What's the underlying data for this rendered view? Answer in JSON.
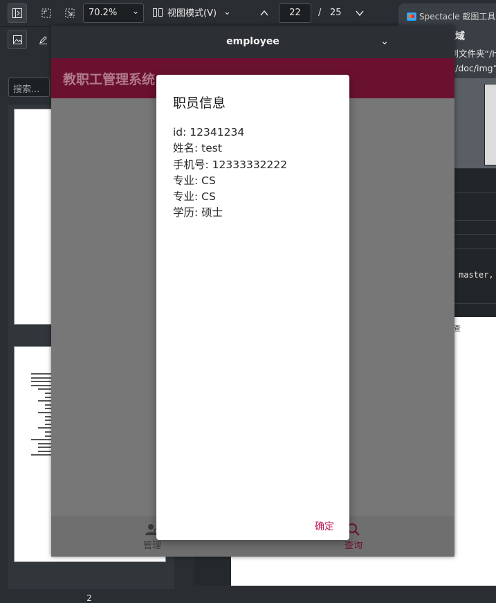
{
  "toolbar": {
    "zoom_value": "70.2%",
    "view_mode_label": "视图模式(V)",
    "current_page": "22",
    "page_separator": "/",
    "total_pages": "25"
  },
  "sidebar": {
    "search_placeholder": "搜索...",
    "thumbnail_label": "2"
  },
  "notification": {
    "app_name": "Spectacle 截图工具",
    "title": "绘制矩形区域",
    "body_line1": "截图已保存到文件夹“/h",
    "body_line2": "cpp/Design/doc/img”"
  },
  "terminal": {
    "text": "master,"
  },
  "document": {
    "fragment": "查"
  },
  "app": {
    "window_title": "employee",
    "header_title": "教职工管理系统",
    "tabs": {
      "manage": "管理",
      "query": "查询"
    },
    "colors": {
      "header": "#6b1130",
      "accent": "#c2185b"
    }
  },
  "dialog": {
    "title": "职员信息",
    "fields": [
      "id: 12341234",
      "姓名: test",
      "手机号: 12333332222",
      "专业: CS",
      "专业: CS",
      "学历: 硕士"
    ],
    "ok_label": "确定"
  }
}
